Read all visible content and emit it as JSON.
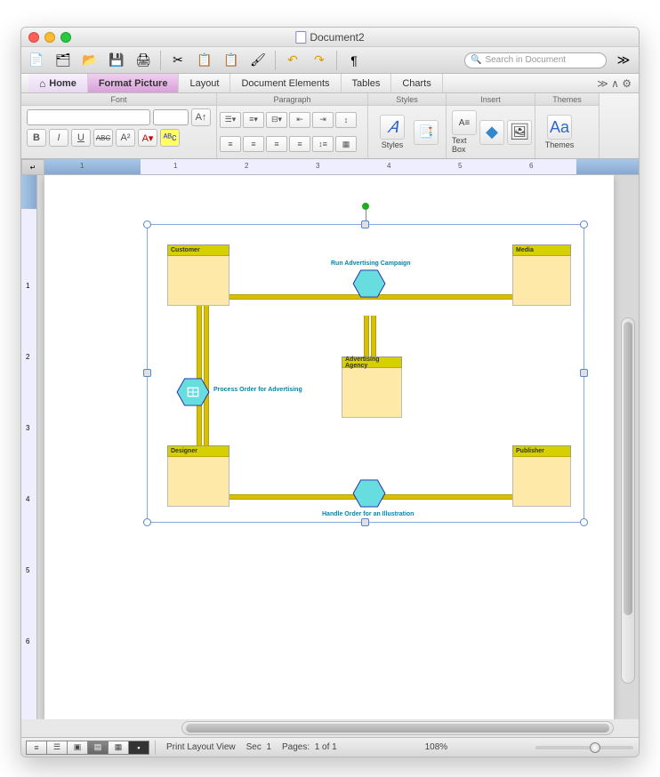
{
  "window": {
    "title": "Document2"
  },
  "search": {
    "placeholder": "Search in Document"
  },
  "tabs": {
    "home": "Home",
    "format": "Format Picture",
    "layout": "Layout",
    "docel": "Document Elements",
    "tables": "Tables",
    "charts": "Charts"
  },
  "ribbon": {
    "font": {
      "title": "Font",
      "bold": "B",
      "italic": "I",
      "under": "U",
      "strike": "ABC"
    },
    "para": {
      "title": "Paragraph"
    },
    "styles": {
      "title": "Styles",
      "btn": "Styles"
    },
    "insert": {
      "title": "Insert",
      "textbox": "Text Box"
    },
    "themes": {
      "title": "Themes",
      "btn": "Themes"
    }
  },
  "diagram": {
    "nodes": {
      "customer": "Customer",
      "media": "Media",
      "agency": "Advertising Agency",
      "designer": "Designer",
      "publisher": "Publisher"
    },
    "hex": {
      "run": "Run Advertising Campaign",
      "process": "Process Order for Advertising",
      "handle": "Handle Order for an Illustration"
    }
  },
  "status": {
    "view": "Print Layout View",
    "sec_lbl": "Sec",
    "sec": "1",
    "pages_lbl": "Pages:",
    "pages": "1 of 1",
    "zoom": "108%"
  }
}
